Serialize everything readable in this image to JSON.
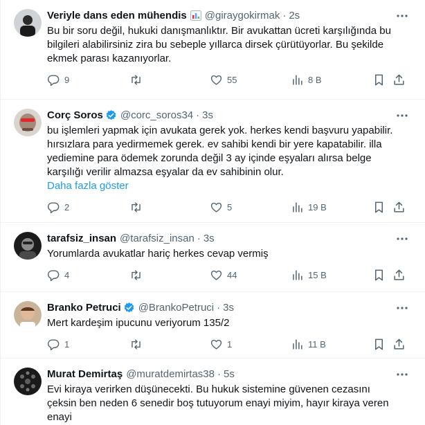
{
  "tweets": [
    {
      "name": "Veriyle dans eden mühendis",
      "name_emoji": "bar-chart-emoji",
      "verified": false,
      "handle": "@giraygokirmak",
      "time": "2s",
      "text": "Bu bir soru değil, hukuki danışmanlıktır. Bir avukattan ücreti karşılığında bu bilgileri alabilirsiniz zira bu sebeple yıllarca dirsek çürütüyorlar. Bu şekilde ekmek parası kazanıyorlar.",
      "show_more": "",
      "replies": "9",
      "retweets": "",
      "likes": "55",
      "views": "8 B"
    },
    {
      "name": "Corç Soros",
      "verified": true,
      "handle": "@corc_soros34",
      "time": "3s",
      "text": "bu işlemleri yapmak için avukata gerek yok. herkes kendi başvuru yapabilir. hırsızlara para yedirmemek gerek. ev sahibi kendi bir yere kapatabilir. illa yediemine para ödemek zorunda değil 3 ay içinde eşyaları alırsa belge karşılığı verilir almazsa eşyalar da ev sahibinin olur.",
      "show_more": "Daha fazla göster",
      "replies": "2",
      "retweets": "",
      "likes": "5",
      "views": "19 B"
    },
    {
      "name": "tarafsiz_insan",
      "verified": false,
      "handle": "@tarafsiz_insan",
      "time": "3s",
      "text": "Yorumlarda avukatlar hariç herkes cevap vermiş",
      "show_more": "",
      "replies": "4",
      "retweets": "",
      "likes": "44",
      "views": "15 B"
    },
    {
      "name": "Branko Petruci",
      "verified": true,
      "handle": "@BrankoPetruci",
      "time": "3s",
      "text": "Mert kardeşim ipucunu veriyorum 135/2",
      "show_more": "",
      "replies": "1",
      "retweets": "",
      "likes": "1",
      "views": "11 B"
    },
    {
      "name": "Murat Demirtaş",
      "verified": false,
      "handle": "@muratdemirtas38",
      "time": "5s",
      "text": "Evi kiraya verirken düşünecekti. Bu hukuk sistemine güvenen cezasını çeksin ben neden 6 senedir boş tutuyorum enayi miyim, hayır kiraya veren enayi",
      "show_more": ""
    }
  ],
  "colors": {
    "text": "#0f1419",
    "secondary": "#536471",
    "link": "#1d9bf0",
    "verified": "#1d9bf0",
    "divider": "#eff3f4"
  },
  "separator": "·"
}
